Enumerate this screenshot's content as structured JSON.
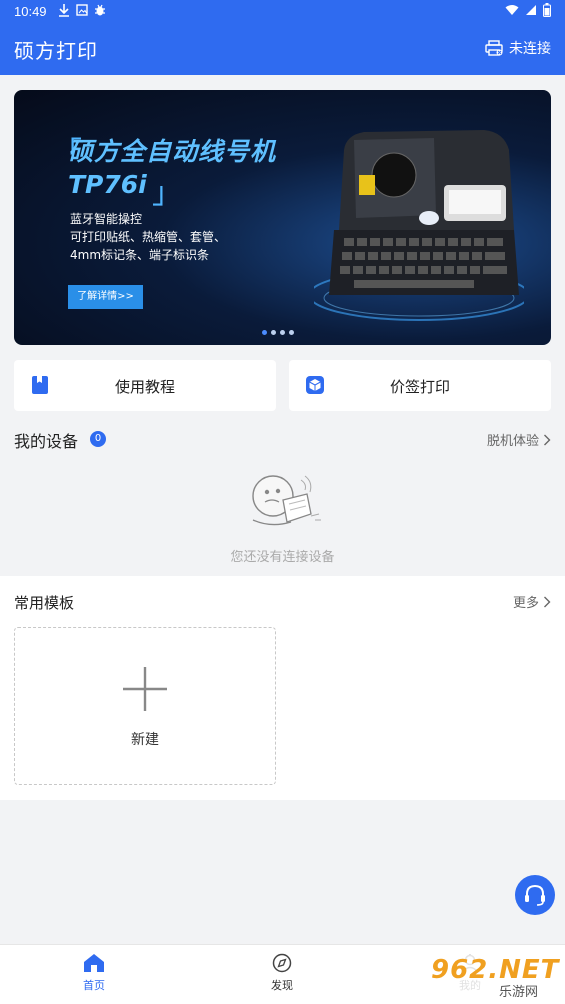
{
  "status_bar": {
    "time": "10:49",
    "left_icons": [
      "download-icon",
      "image-icon",
      "bug-icon"
    ],
    "right_icons": [
      "wifi-icon",
      "signal-icon",
      "battery-icon"
    ]
  },
  "app_bar": {
    "title": "硕方打印",
    "connection_status": "未连接",
    "accent": "#2f6bf0"
  },
  "banner": {
    "bracket_open": "「",
    "title_line1": "硕方全自动线号机",
    "title_line2": "TP76i",
    "bracket_close": "」",
    "desc": [
      "蓝牙智能操控",
      "可打印贴纸、热缩管、套管、",
      "4mm标记条、端子标识条"
    ],
    "cta": "了解详情>>",
    "page_count": 4,
    "active_page": 1
  },
  "quick_actions": [
    {
      "label": "使用教程",
      "icon": "book-icon"
    },
    {
      "label": "价签打印",
      "icon": "cube-icon"
    }
  ],
  "devices": {
    "title": "我的设备",
    "count": "0",
    "offline_link": "脱机体验",
    "empty_text": "您还没有连接设备"
  },
  "templates": {
    "title": "常用模板",
    "more_link": "更多",
    "new_label": "新建"
  },
  "bottom_nav": [
    {
      "label": "首页",
      "icon": "home-icon",
      "active": true
    },
    {
      "label": "发现",
      "icon": "compass-icon",
      "active": false
    },
    {
      "label": "我的",
      "icon": "user-icon",
      "active": false
    }
  ],
  "watermark": {
    "logo": "962.NET",
    "sub": "乐游网"
  }
}
